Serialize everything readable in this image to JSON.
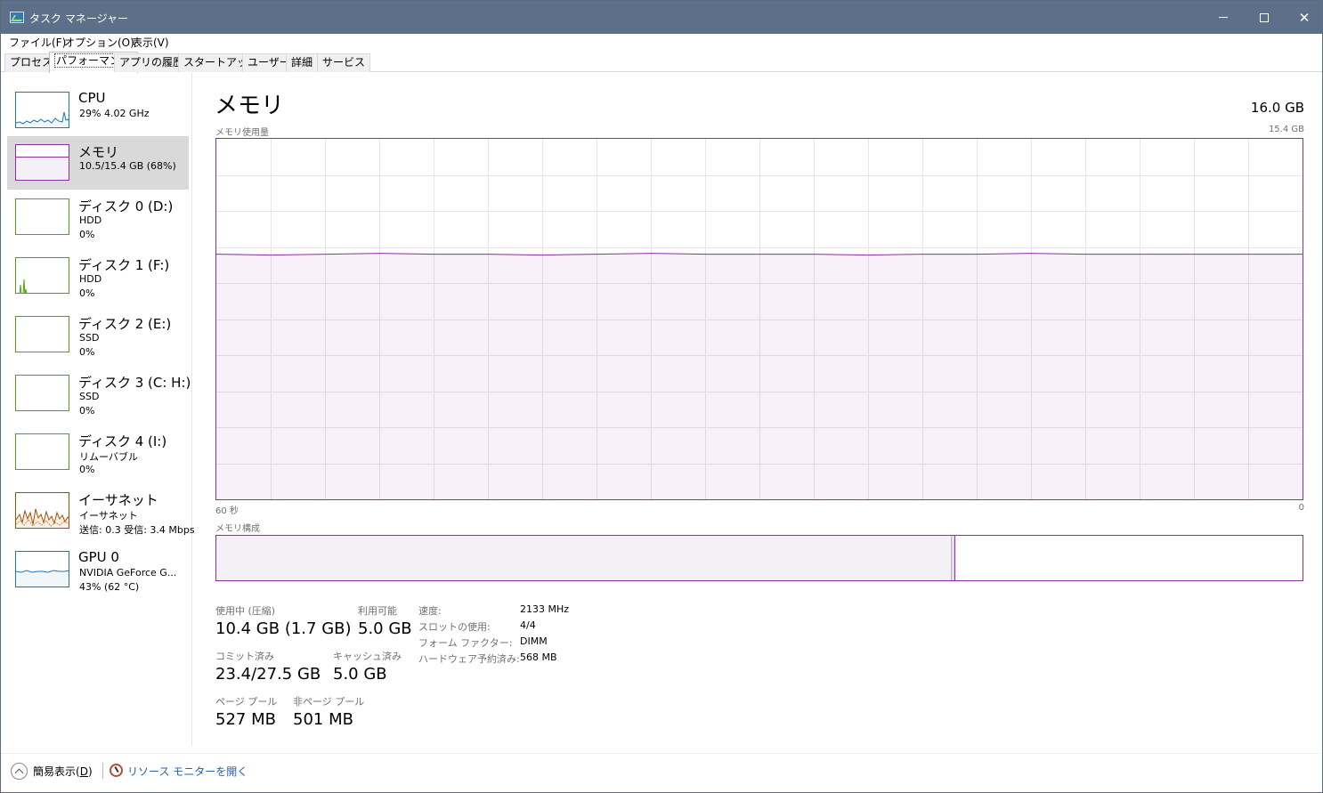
{
  "window": {
    "title": "タスク マネージャー"
  },
  "menu": [
    "ファイル(F)",
    "オプション(O)",
    "表示(V)"
  ],
  "tabs": [
    "プロセス",
    "パフォーマンス",
    "アプリの履歴",
    "スタートアップ",
    "ユーザー",
    "詳細",
    "サービス"
  ],
  "active_tab": "パフォーマンス",
  "sidebar": {
    "items": [
      {
        "name": "CPU",
        "line2": "29%  4.02 GHz",
        "line3": "",
        "color": "#1779ba"
      },
      {
        "name": "メモリ",
        "line2": "10.5/15.4 GB (68%)",
        "line3": "",
        "color": "#8b2fa5"
      },
      {
        "name": "ディスク 0 (D:)",
        "line2": "HDD",
        "line3": "0%",
        "color": "#4ca60c"
      },
      {
        "name": "ディスク 1 (F:)",
        "line2": "HDD",
        "line3": "0%",
        "color": "#4ca60c"
      },
      {
        "name": "ディスク 2 (E:)",
        "line2": "SSD",
        "line3": "0%",
        "color": "#4ca60c"
      },
      {
        "name": "ディスク 3 (C: H:)",
        "line2": "SSD",
        "line3": "0%",
        "color": "#4ca60c"
      },
      {
        "name": "ディスク 4 (I:)",
        "line2": "リムーバブル",
        "line3": "0%",
        "color": "#4ca60c"
      },
      {
        "name": "イーサネット",
        "line2": "イーサネット",
        "line3": "送信: 0.3  受信: 3.4 Mbps",
        "color": "#a74f01"
      },
      {
        "name": "GPU 0",
        "line2": "NVIDIA GeForce G...",
        "line3": "43% (62 °C)",
        "color": "#1779ba"
      }
    ]
  },
  "main": {
    "title": "メモリ",
    "total": "16.0 GB",
    "usage_label": "メモリ使用量",
    "usage_max": "15.4 GB",
    "time_left": "60 秒",
    "time_right": "0",
    "composition_label": "メモリ構成",
    "usage_fraction": 0.68,
    "composition_in_use_fraction": 0.676,
    "composition_modified_fraction": 0.004
  },
  "stats": {
    "in_use_label": "使用中 (圧縮)",
    "in_use_value": "10.4 GB (1.7 GB)",
    "available_label": "利用可能",
    "available_value": "5.0 GB",
    "committed_label": "コミット済み",
    "committed_value": "23.4/27.5 GB",
    "cached_label": "キャッシュ済み",
    "cached_value": "5.0 GB",
    "paged_label": "ページ プール",
    "paged_value": "527 MB",
    "nonpaged_label": "非ページ プール",
    "nonpaged_value": "501 MB"
  },
  "details": [
    {
      "key": "速度:",
      "value": "2133 MHz"
    },
    {
      "key": "スロットの使用:",
      "value": "4/4"
    },
    {
      "key": "フォーム ファクター:",
      "value": "DIMM"
    },
    {
      "key": "ハードウェア予約済み:",
      "value": "568 MB"
    }
  ],
  "footer": {
    "fewer_details": "簡易表示(",
    "fewer_key": "D",
    "fewer_end": ")",
    "resource_monitor": "リソース モニターを開く"
  },
  "icons": {
    "app": "task-manager-icon",
    "collapse": "chevron-up-icon",
    "resmon": "resource-monitor-icon"
  }
}
